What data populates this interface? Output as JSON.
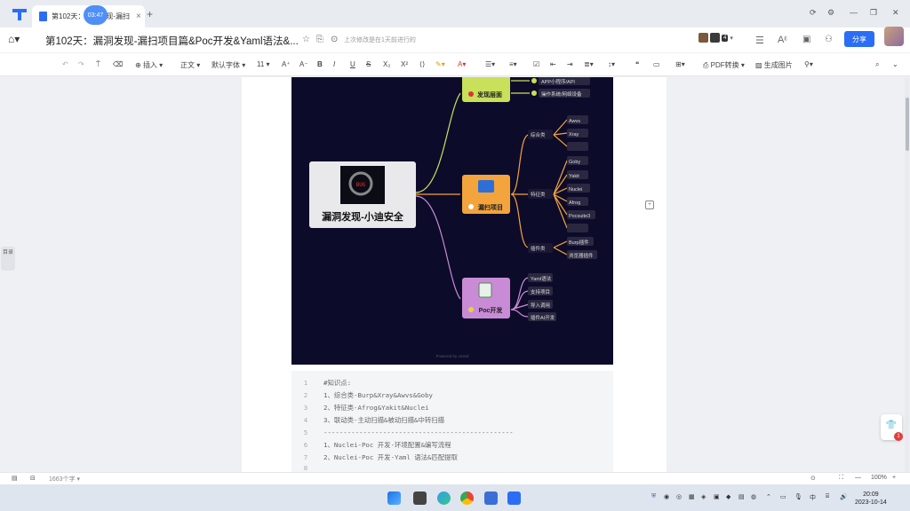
{
  "tabs": {
    "doc_tab_title": "第102天：漏洞发现-漏扫",
    "timer": "03:47",
    "close": "×",
    "add": "+"
  },
  "header": {
    "title": "第102天：漏洞发现-漏扫项目篇&Poc开发&Yaml语法&...",
    "last_edit": "上次修改是在1天前进行的",
    "collab_count": "4",
    "share_label": "分享"
  },
  "toolbar": {
    "insert_label": "插入",
    "style_label": "正文",
    "font_label": "默认字体",
    "size_label": "11",
    "pdf_label": "PDF转换",
    "image_label": "生成图片"
  },
  "sidebar": {
    "toc_label": "目录"
  },
  "mindmap": {
    "root": "漏洞发现-小迪安全",
    "bug_label": "BUG",
    "top_node": "发现层面",
    "top_children": [
      "APP小程序/API",
      "操作系统/网络设备"
    ],
    "mid_node": "漏扫项目",
    "mid_groups": [
      {
        "label": "综合类",
        "items": [
          "Awvs",
          "Xray",
          ""
        ]
      },
      {
        "label": "特征类",
        "items": [
          "Goby",
          "Yakit",
          "Nuclei",
          "Afrog",
          "Pocsuite3",
          ""
        ]
      },
      {
        "label": "插件类",
        "items": [
          "Burp插件",
          "浏览器插件"
        ]
      }
    ],
    "bottom_node": "Poc开发",
    "bottom_children": [
      "Yaml语法",
      "支持项目",
      "导入调用",
      "插件AI开发"
    ],
    "watermark": "Powered by xmind"
  },
  "code": {
    "lines": [
      {
        "num": "1",
        "text": "#知识点:"
      },
      {
        "num": "2",
        "text": "1、综合类-Burp&Xray&Awvs&Goby"
      },
      {
        "num": "3",
        "text": "2、特征类-Afrog&Yakit&Nuclei"
      },
      {
        "num": "4",
        "text": "3、联动类-主动扫描&被动扫描&中转扫描"
      },
      {
        "num": "5",
        "text": "------------------------------------------------"
      },
      {
        "num": "6",
        "text": "1、Nuclei-Poc 开发-环境配置&编写流程"
      },
      {
        "num": "7",
        "text": "2、Nuclei-Poc 开发-Yaml 语法&匹配提取"
      },
      {
        "num": "8",
        "text": ""
      }
    ]
  },
  "status": {
    "word_count": "1663个字",
    "zoom": "100%"
  },
  "taskbar": {
    "time": "20:09",
    "date": "2023-10-14"
  },
  "colors": {
    "accent": "#2b6ef5",
    "mindmap_bg": "#0d0b2a",
    "node_yellow": "#c8e05a",
    "node_orange": "#f3a43c",
    "node_purple": "#c98bd6"
  }
}
